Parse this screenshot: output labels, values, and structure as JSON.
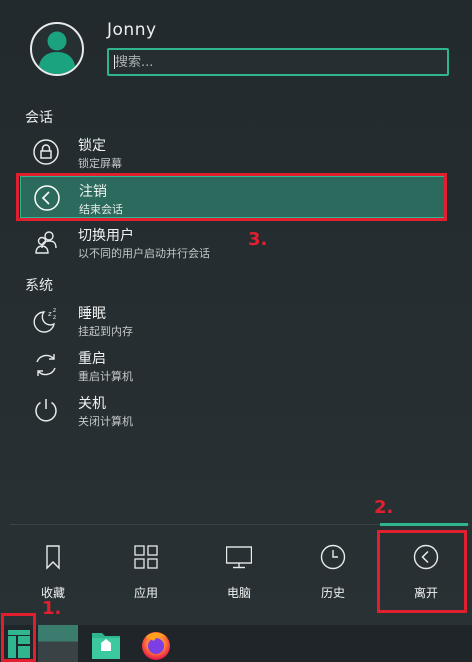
{
  "user": {
    "name": "Jonny"
  },
  "search": {
    "placeholder": "搜索..."
  },
  "sections": {
    "session": "会话",
    "system": "系统"
  },
  "session_items": [
    {
      "title": "锁定",
      "subtitle": "锁定屏幕",
      "icon": "lock-icon"
    },
    {
      "title": "注销",
      "subtitle": "结束会话",
      "icon": "logout-icon",
      "selected": true
    },
    {
      "title": "切换用户",
      "subtitle": "以不同的用户启动并行会话",
      "icon": "switch-user-icon"
    }
  ],
  "system_items": [
    {
      "title": "睡眠",
      "subtitle": "挂起到内存",
      "icon": "sleep-icon"
    },
    {
      "title": "重启",
      "subtitle": "重启计算机",
      "icon": "restart-icon"
    },
    {
      "title": "关机",
      "subtitle": "关闭计算机",
      "icon": "power-icon"
    }
  ],
  "tabs": [
    {
      "label": "收藏",
      "icon": "bookmark-icon"
    },
    {
      "label": "应用",
      "icon": "apps-grid-icon"
    },
    {
      "label": "电脑",
      "icon": "computer-icon"
    },
    {
      "label": "历史",
      "icon": "clock-icon"
    },
    {
      "label": "离开",
      "icon": "leave-icon",
      "active": true
    }
  ],
  "annotations": [
    "1.",
    "2.",
    "3."
  ],
  "colors": {
    "accent": "#2fb58f",
    "selected_bg": "#2b6a5c",
    "annotation_red": "#e01f2f",
    "background": "#252c2f"
  }
}
